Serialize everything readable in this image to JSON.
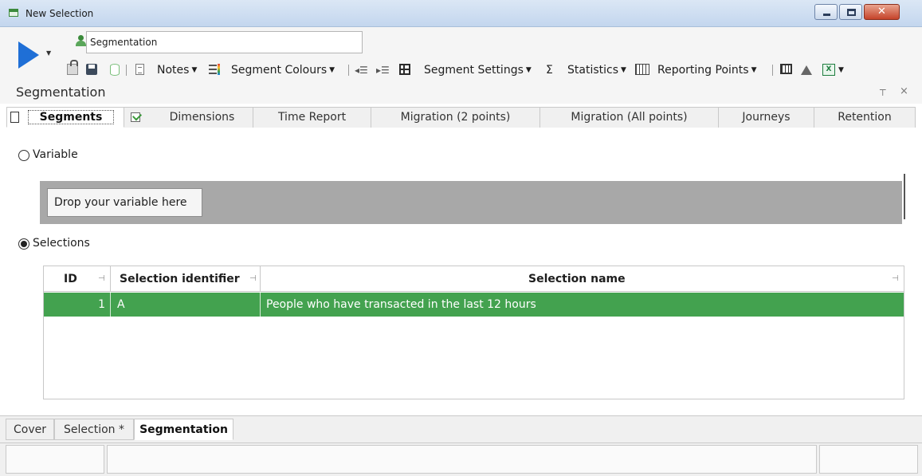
{
  "window": {
    "title": "New Selection",
    "icon": "window-icon"
  },
  "header": {
    "name_value": "Segmentation",
    "run_icon": "play-icon"
  },
  "toolbar": {
    "notes": "Notes",
    "segment_colours": "Segment Colours",
    "segment_settings": "Segment Settings",
    "statistics": "Statistics",
    "reporting_points": "Reporting Points",
    "sigma": "Σ"
  },
  "panel": {
    "title": "Segmentation",
    "pin_glyph": "⊤",
    "close_glyph": "×"
  },
  "tabs": [
    {
      "label": "Segments",
      "active": true
    },
    {
      "label": "Dimensions",
      "active": false
    },
    {
      "label": "Time Report",
      "active": false
    },
    {
      "label": "Migration (2 points)",
      "active": false
    },
    {
      "label": "Migration (All points)",
      "active": false
    },
    {
      "label": "Journeys",
      "active": false
    },
    {
      "label": "Retention",
      "active": false
    }
  ],
  "content": {
    "variable_label": "Variable",
    "variable_selected": false,
    "drop_label": "Drop your variable here",
    "selections_label": "Selections",
    "selections_selected": true
  },
  "grid": {
    "columns": [
      "ID",
      "Selection identifier",
      "Selection name"
    ],
    "rows": [
      {
        "id": "1",
        "identifier": "A",
        "name": "People who have transacted in the last 12 hours"
      }
    ],
    "selected_row_color": "#43a24f"
  },
  "doc_tabs": [
    {
      "label": "Cover",
      "active": false
    },
    {
      "label": "Selection *",
      "active": false
    },
    {
      "label": "Segmentation",
      "active": true
    }
  ]
}
